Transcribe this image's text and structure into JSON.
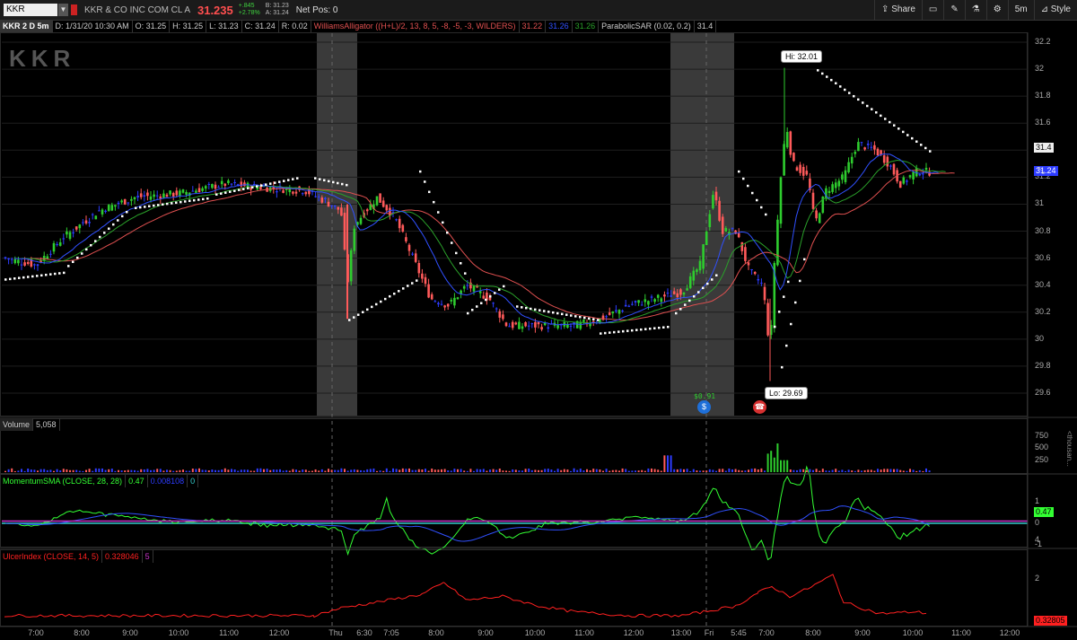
{
  "toolbar": {
    "symbol": "KKR",
    "company": "KKR & CO INC COM CL A",
    "last": "31.235",
    "change_top": "+.845",
    "change_bottom": "+2.78%",
    "bid": "B: 31.23",
    "ask": "A: 31.24",
    "net_pos": "Net Pos: 0",
    "share_label": "Share",
    "period_label": "5m",
    "style_label": "Style"
  },
  "price_header": {
    "title": "KKR 2 D 5m",
    "date": "D: 1/31/20 10:30 AM",
    "open": "O: 31.25",
    "high": "H: 31.25",
    "low": "L: 31.23",
    "close": "C: 31.24",
    "range": "R: 0.02",
    "alligator_label": "WilliamsAlligator ((H+L)/2, 13, 8, 5, -8, -5, -3, WILDERS)",
    "alligator_v1": "31.22",
    "alligator_v2": "31.26",
    "alligator_v3": "31.26",
    "sar_label": "ParabolicSAR (0.02, 0.2)",
    "sar_value": "31.4"
  },
  "watermark": "KKR",
  "annotations": {
    "hi": "Hi: 32.01",
    "lo": "Lo: 29.69",
    "dividend": "$0.91",
    "dividend_icon": "dividend-icon",
    "earnings_icon": "phone-icon"
  },
  "price_axis": [
    "32.2",
    "32",
    "31.8",
    "31.6",
    "31.4",
    "31.2",
    "31",
    "30.8",
    "30.6",
    "30.4",
    "30.2",
    "30",
    "29.8",
    "29.6"
  ],
  "price_markers": {
    "sar": "31.4",
    "last": "31.24"
  },
  "volume_header": {
    "label": "Volume",
    "value": "5,058"
  },
  "volume_axis": [
    "750",
    "500",
    "250"
  ],
  "volume_unit": "<thousan...",
  "momentum_header": {
    "label": "MomentumSMA (CLOSE, 28, 28)",
    "v1": "0.47",
    "v2": "0.008108",
    "v3": "0"
  },
  "momentum_axis": [
    "1",
    "0",
    "-1"
  ],
  "momentum_marker": "0.47",
  "ulcer_header": {
    "label": "UlcerIndex (CLOSE, 14, 5)",
    "v1": "0.328046",
    "v2": "5"
  },
  "ulcer_axis": [
    "4",
    "2"
  ],
  "ulcer_marker": "0.32805",
  "time_axis": [
    "7:00",
    "8:00",
    "9:00",
    "10:00",
    "11:00",
    "12:00",
    "Thu",
    "6:30",
    "7:05",
    "8:00",
    "9:00",
    "10:00",
    "11:00",
    "12:00",
    "13:00",
    "Fri",
    "5:45",
    "7:00",
    "8:00",
    "9:00",
    "10:00",
    "11:00",
    "12:00"
  ],
  "colors": {
    "up": "#2ecc2e",
    "down": "#ff5a5a",
    "neutral": "#2d3cff",
    "sar": "#ffffff",
    "jaw": "#e05050",
    "teeth": "#2aa02a",
    "lips": "#3050ff",
    "momentum": "#33ff33",
    "ulcer": "#ff2020"
  }
}
